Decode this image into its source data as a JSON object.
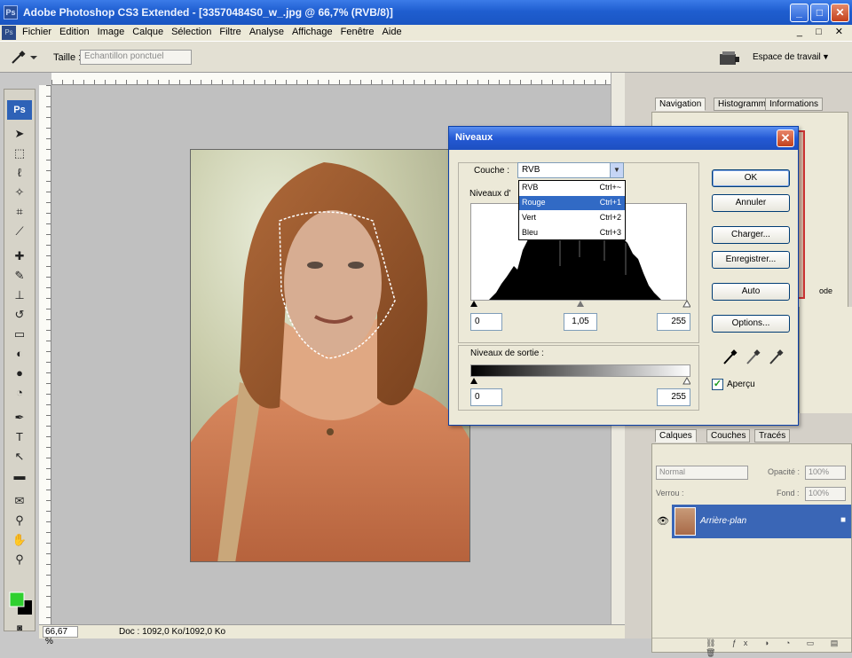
{
  "window": {
    "title": "Adobe Photoshop CS3 Extended - [33570484S0_w_.jpg @ 66,7% (RVB/8)]",
    "minimize": "_",
    "maximize": "□",
    "close": "✕",
    "doc_controls": "_ □ ✕"
  },
  "menu": [
    "Fichier",
    "Edition",
    "Image",
    "Calque",
    "Sélection",
    "Filtre",
    "Analyse",
    "Affichage",
    "Fenêtre",
    "Aide"
  ],
  "options_bar": {
    "taille_label": "Taille :",
    "taille_value": "Echantillon ponctuel",
    "workspace_label": "Espace de travail",
    "workspace_arrow": "▼"
  },
  "toolbox": {
    "logo": "Ps"
  },
  "status": {
    "zoom": "66,67 %",
    "doc": "Doc : 1092,0 Ko/1092,0 Ko"
  },
  "colors": {
    "foreground": "#2fd02f",
    "background": "#000000",
    "titlebar": "#1f5ed0",
    "selection": "#316ac5"
  },
  "dialog": {
    "title": "Niveaux",
    "close": "✕",
    "couche_label": "Couche :",
    "couche_value": "RVB",
    "niveaux_label": "Niveaux d'",
    "dropdown_options": [
      {
        "label": "RVB",
        "shortcut": "Ctrl+~",
        "selected": false
      },
      {
        "label": "Rouge",
        "shortcut": "Ctrl+1",
        "selected": true
      },
      {
        "label": "Vert",
        "shortcut": "Ctrl+2",
        "selected": false
      },
      {
        "label": "Bleu",
        "shortcut": "Ctrl+3",
        "selected": false
      }
    ],
    "input_black": "0",
    "input_gamma": "1,05",
    "input_white": "255",
    "output_label": "Niveaux de sortie :",
    "output_black": "0",
    "output_white": "255",
    "buttons": {
      "ok": "OK",
      "annuler": "Annuler",
      "charger": "Charger...",
      "enregistrer": "Enregistrer...",
      "auto": "Auto",
      "options": "Options..."
    },
    "apercu_label": "Aperçu",
    "apercu_checked": true
  },
  "panels": {
    "top_tabs": [
      "Navigation",
      "Histogramme",
      "Informations"
    ],
    "layers_tabs": [
      "Calques",
      "Couches",
      "Tracés"
    ],
    "blend_mode": "Normal",
    "opacity_label": "Opacité :",
    "opacity": "100%",
    "lock_label": "Verrou :",
    "fill_label": "Fond :",
    "fill": "100%",
    "layer_name": "Arrière-plan",
    "zoom_tail": "ode"
  }
}
